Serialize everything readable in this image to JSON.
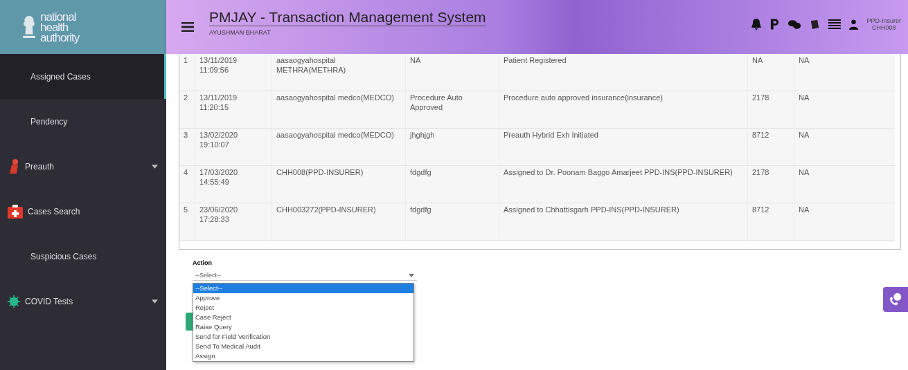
{
  "header": {
    "logo": [
      "national",
      "health",
      "authority"
    ],
    "title": "PMJAY - Transaction Management System",
    "subtitle": "AYUSHMAN BHARAT",
    "user": {
      "role": "PPD-Insurer",
      "code": "CHH008"
    }
  },
  "sidebar": {
    "items": [
      {
        "label": "Assigned Cases",
        "kind": "plain",
        "selected": true
      },
      {
        "label": "Pendency",
        "kind": "plain",
        "selected": false
      },
      {
        "label": "Preauth",
        "kind": "expandable",
        "selected": false
      },
      {
        "label": "Cases Search",
        "kind": "iconic",
        "selected": false
      },
      {
        "label": "Suspicious Cases",
        "kind": "plain",
        "selected": false
      },
      {
        "label": "COVID Tests",
        "kind": "expandable",
        "selected": false
      }
    ]
  },
  "table": {
    "rows": [
      [
        "1",
        "13/11/2019 11:09:56",
        "aasaogyahospital METHRA(METHRA)",
        "NA",
        "Patient Registered",
        "NA",
        "NA"
      ],
      [
        "2",
        "13/11/2019 11:20:15",
        "aasaogyahospital medco(MEDCO)",
        "Procedure Auto Approved",
        "Procedure auto approved insurance(insurance)",
        "2178",
        "NA"
      ],
      [
        "3",
        "13/02/2020 19:10:07",
        "aasaogyahospital medco(MEDCO)",
        "jhghjgh",
        "Preauth Hybrid Exh Initiated",
        "8712",
        "NA"
      ],
      [
        "4",
        "17/03/2020 14:55:49",
        "CHH008(PPD-INSURER)",
        "fdgdfg",
        "Assigned to Dr. Poonam Baggo Amarjeet PPD-INS(PPD-INSURER)",
        "2178",
        "NA"
      ],
      [
        "5",
        "23/06/2020 17:28:33",
        "CHH003272(PPD-INSURER)",
        "fdgdfg",
        "Assigned to Chhattisgarh PPD-INS(PPD-INSURER)",
        "8712",
        "NA"
      ]
    ]
  },
  "action": {
    "label": "Action",
    "value": "--Select--",
    "options": [
      {
        "label": "--Select--",
        "selected": true
      },
      {
        "label": "Approve",
        "selected": false
      },
      {
        "label": "Reject",
        "selected": false
      },
      {
        "label": "Case Reject",
        "selected": false
      },
      {
        "label": "Raise Query",
        "selected": false
      },
      {
        "label": "Send for Field Verification",
        "selected": false
      },
      {
        "label": "Send To Medical Audit",
        "selected": false
      },
      {
        "label": "Assign",
        "selected": false
      }
    ]
  }
}
